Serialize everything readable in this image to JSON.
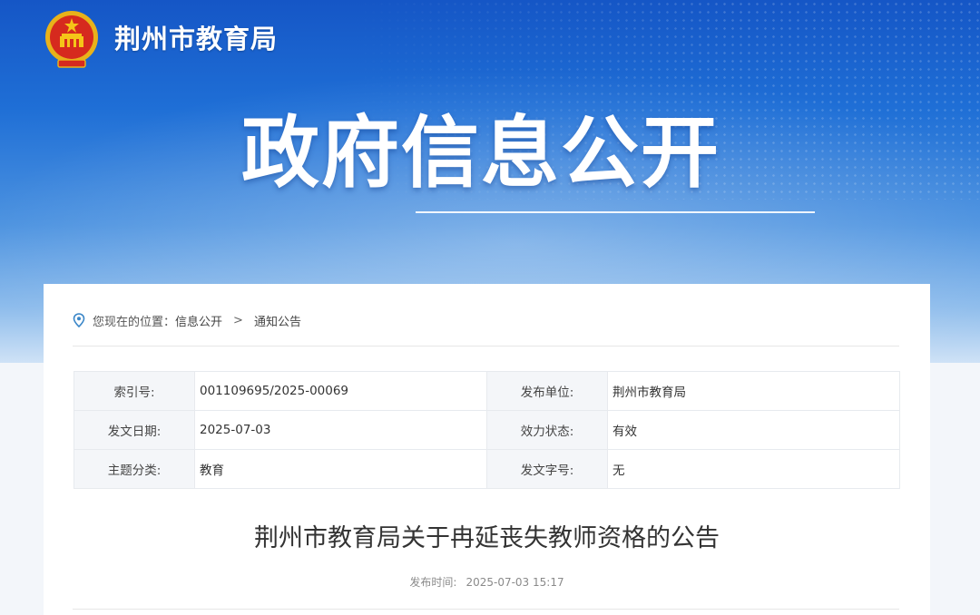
{
  "header": {
    "site_name": "荆州市教育局",
    "hero_title": "政府信息公开",
    "emblem_icon": "national-emblem-icon"
  },
  "breadcrumb": {
    "prefix": "您现在的位置：",
    "items": [
      "信息公开",
      "通知公告"
    ],
    "separator": ">"
  },
  "meta_table": {
    "rows": [
      {
        "label1": "索引号:",
        "value1": "001109695/2025-00069",
        "label2": "发布单位:",
        "value2": "荆州市教育局"
      },
      {
        "label1": "发文日期:",
        "value1": "2025-07-03",
        "label2": "效力状态:",
        "value2": "有效"
      },
      {
        "label1": "主题分类:",
        "value1": "教育",
        "label2": "发文字号:",
        "value2": "无"
      }
    ]
  },
  "article": {
    "title": "荆州市教育局关于冉延丧失教师资格的公告",
    "published_label": "发布时间:",
    "published_time": "2025-07-03 15:17"
  },
  "colors": {
    "banner_top": "#1556c6",
    "banner_bottom": "#cfe2f6",
    "accent": "#3a86c8"
  }
}
